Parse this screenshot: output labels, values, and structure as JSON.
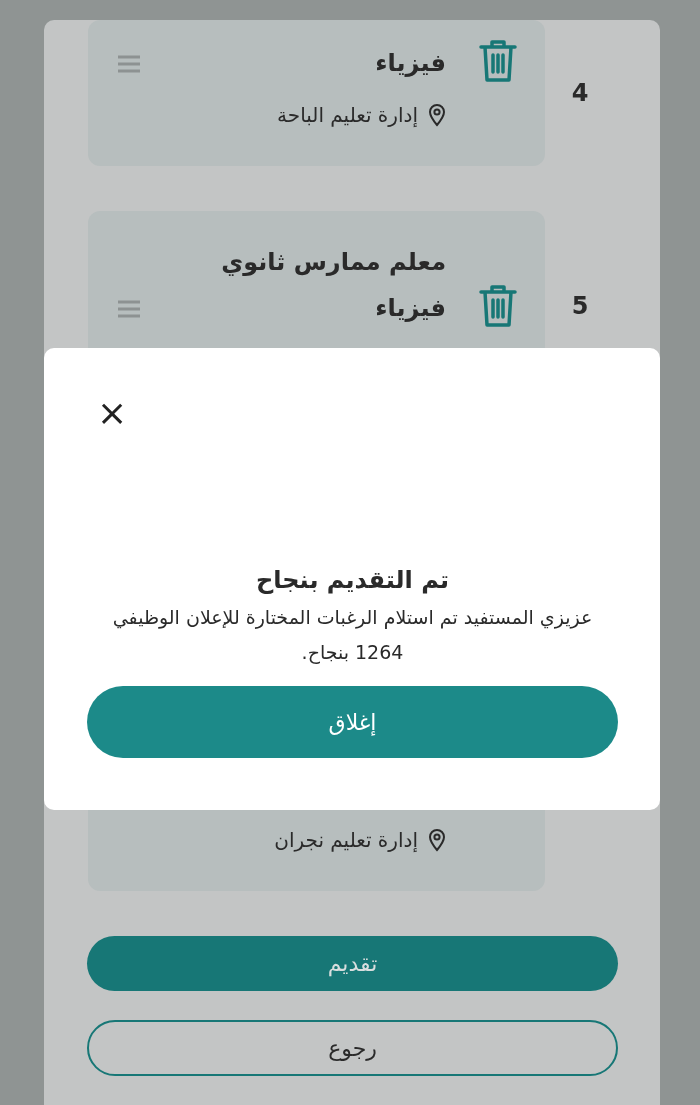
{
  "items": [
    {
      "number": "4",
      "title_lines": [
        "فيزياء"
      ],
      "location": "إدارة تعليم الباحة"
    },
    {
      "number": "5",
      "title_lines": [
        "معلم ممارس ثانوي",
        "فيزياء"
      ]
    },
    {
      "location": "إدارة تعليم نجران"
    }
  ],
  "buttons": [
    {
      "label": "تقديم",
      "kind": "primary"
    },
    {
      "label": "رجوع",
      "kind": "outline"
    }
  ],
  "dialog": {
    "close_icon": "×",
    "title": "تم التقديم بنجاح",
    "message": "عزيزي المستفيد تم استلام الرغبات المختارة للإعلان الوظيفي 1264 بنجاح.",
    "button": "إغلاق"
  }
}
